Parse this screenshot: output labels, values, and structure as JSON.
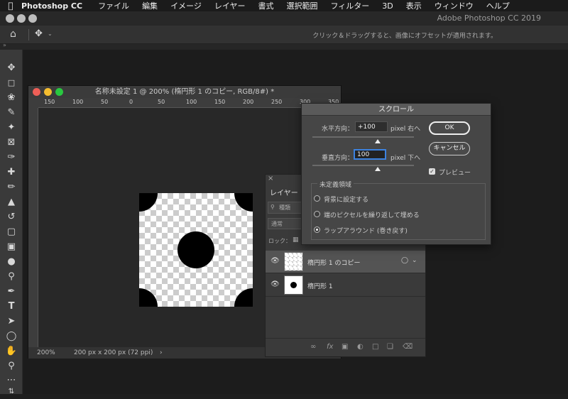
{
  "menubar": {
    "app_name": "Photoshop CC",
    "items": [
      "ファイル",
      "編集",
      "イメージ",
      "レイヤー",
      "書式",
      "選択範囲",
      "フィルター",
      "3D",
      "表示",
      "ウィンドウ",
      "ヘルプ"
    ]
  },
  "window": {
    "title": "Adobe Photoshop CC 2019"
  },
  "options_bar": {
    "hint": "クリック＆ドラッグすると、画像にオフセットが適用されます。"
  },
  "document": {
    "title": "名称未設定 1 @ 200% (楕円形 1 のコピー, RGB/8#) *",
    "zoom": "200%",
    "size_info": "200 px x 200 px (72 ppi)",
    "ruler_ticks": [
      "150",
      "100",
      "50",
      "0",
      "50",
      "100",
      "150",
      "200",
      "250",
      "300",
      "350"
    ]
  },
  "layers_panel": {
    "tab": "レイヤー",
    "search_placeholder": "種類",
    "blend_mode": "通常",
    "lock_label": "ロック：",
    "layers": [
      {
        "name": "楕円形 1 のコピー",
        "visible": true,
        "selected": true
      },
      {
        "name": "楕円形 1",
        "visible": true,
        "selected": false
      }
    ]
  },
  "dialog": {
    "title": "スクロール",
    "horizontal_label": "水平方向：",
    "horizontal_value": "+100",
    "horizontal_unit": "pixel 右へ",
    "vertical_label": "垂直方向：",
    "vertical_value": "100",
    "vertical_unit": "pixel 下へ",
    "ok": "OK",
    "cancel": "キャンセル",
    "preview": "プレビュー",
    "preview_checked": true,
    "undefined_area_label": "未定義領域",
    "options": [
      {
        "label": "背景に設定する",
        "selected": false
      },
      {
        "label": "端のピクセルを繰り返して埋める",
        "selected": false
      },
      {
        "label": "ラップアラウンド (巻き戻す)",
        "selected": true
      }
    ]
  }
}
